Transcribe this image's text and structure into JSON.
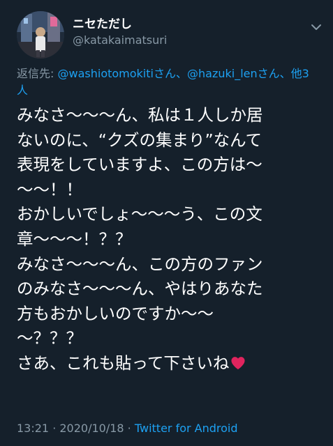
{
  "author": {
    "display_name": "ニセただし",
    "handle": "@katakaimatsuri",
    "icon": "chevron-down-icon"
  },
  "reply": {
    "label": "返信先:",
    "mentions": [
      "@washiotomokitiさん",
      "@hazuki_lenさん"
    ],
    "separator": "、",
    "others": "、他3人"
  },
  "tweet": {
    "lines": [
      "みなさ〜〜〜ん、私は１人しか居",
      "ないのに、“クズの集まり”なんて",
      "表現をしていますよ、この方は〜",
      "〜〜！！",
      "おかしいでしょ〜〜〜う、この文",
      "章〜〜〜！？？",
      "みなさ〜〜〜ん、この方のファン",
      "のみなさ〜〜〜ん、やはりあなた",
      "方もおかしいのですか〜〜",
      "〜？？？",
      "さあ、これも貼って下さいね"
    ],
    "emoji": "red-heart-icon"
  },
  "meta": {
    "time": "13:21",
    "dot1": " · ",
    "date": "2020/10/18",
    "dot2": " · ",
    "source": "Twitter for Android"
  },
  "colors": {
    "background": "#15202b",
    "text": "#ffffff",
    "muted": "#8899a6",
    "link": "#1da1f2",
    "heart": "#e0245e"
  }
}
